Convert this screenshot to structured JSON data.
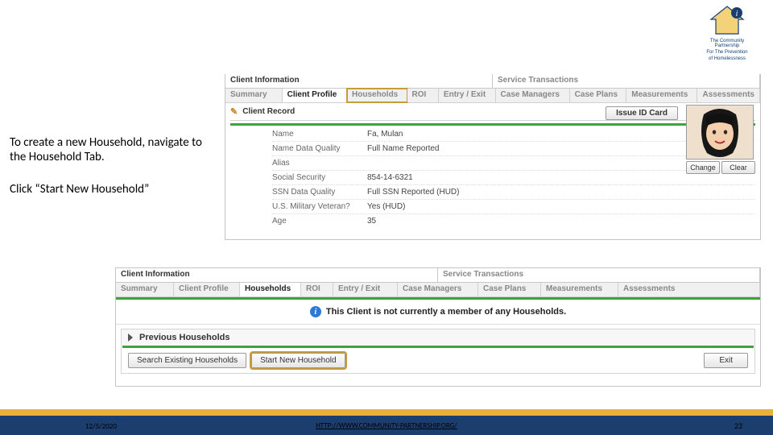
{
  "logo": {
    "line1": "The Community Partnership",
    "line2": "For The Prevention",
    "line3": "of Homelessness"
  },
  "instructions": {
    "p1": "To create a new Household, navigate to the Household Tab.",
    "p2": "Click “Start New Household”"
  },
  "panel1": {
    "mainTabs": {
      "left": "Client Information",
      "right": "Service Transactions"
    },
    "subTabs": [
      "Summary",
      "Client Profile",
      "Households",
      "ROI",
      "Entry / Exit",
      "Case Managers",
      "Case Plans",
      "Measurements",
      "Assessments"
    ],
    "recordTitle": "Client Record",
    "issueBtn": "Issue ID Card",
    "fields": [
      {
        "label": "Name",
        "value": "Fa, Mulan"
      },
      {
        "label": "Name Data Quality",
        "value": "Full Name Reported"
      },
      {
        "label": "Alias",
        "value": ""
      },
      {
        "label": "Social Security",
        "value": "854-14-6321"
      },
      {
        "label": "SSN Data Quality",
        "value": "Full SSN Reported (HUD)"
      },
      {
        "label": "U.S. Military Veteran?",
        "value": "Yes (HUD)"
      },
      {
        "label": "Age",
        "value": "35"
      }
    ],
    "photoBtns": {
      "change": "Change",
      "clear": "Clear"
    }
  },
  "panel2": {
    "mainTabs": {
      "left": "Client Information",
      "right": "Service Transactions"
    },
    "subTabs": [
      "Summary",
      "Client Profile",
      "Households",
      "ROI",
      "Entry / Exit",
      "Case Managers",
      "Case Plans",
      "Measurements",
      "Assessments"
    ],
    "infoText": "This Client is not currently a member of any Households.",
    "prevHeader": "Previous Households",
    "buttons": {
      "search": "Search Existing Households",
      "start": "Start New Household",
      "exit": "Exit"
    }
  },
  "footer": {
    "date": "12/5/2020",
    "link": "HTTP://WWW.COMMUNITY-PARTNERSHIP.ORG/",
    "page": "23"
  }
}
